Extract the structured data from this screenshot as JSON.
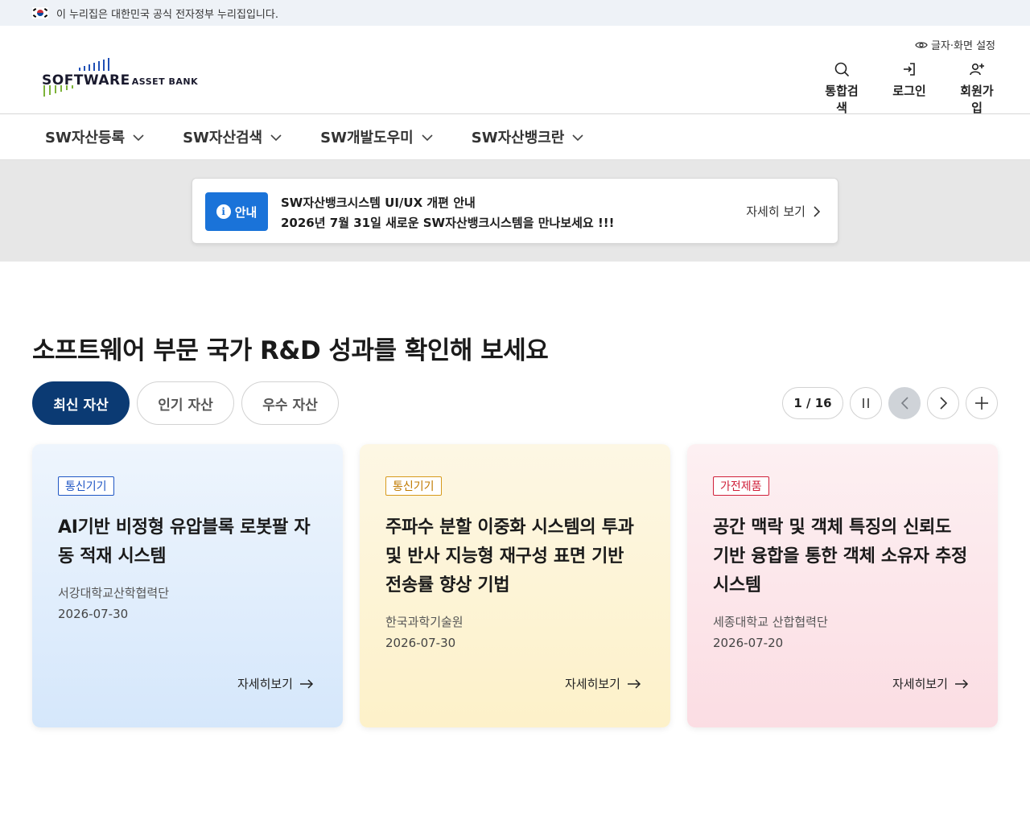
{
  "gov_banner": {
    "text": "이 누리집은 대한민국 공식 전자정부 누리집입니다."
  },
  "logo": {
    "main": "SOFTWARE",
    "sub": "ASSET BANK"
  },
  "header": {
    "settings_label": "글자·화면 설정",
    "utility": [
      {
        "label": "통합검색",
        "icon": "search-icon"
      },
      {
        "label": "로그인",
        "icon": "login-icon"
      },
      {
        "label": "회원가입",
        "icon": "user-add-icon"
      }
    ]
  },
  "nav": {
    "items": [
      {
        "label": "SW자산등록"
      },
      {
        "label": "SW자산검색"
      },
      {
        "label": "SW개발도우미"
      },
      {
        "label": "SW자산뱅크란"
      }
    ]
  },
  "notice": {
    "badge": "안내",
    "line1": "SW자산뱅크시스템 UI/UX 개편 안내",
    "line2": "2026년 7월 31일 새로운 SW자산뱅크시스템을 만나보세요 !!!",
    "more": "자세히 보기"
  },
  "section": {
    "title": "소프트웨어 부문 국가 R&D 성과를 확인해 보세요",
    "tabs": [
      {
        "label": "최신 자산",
        "active": true
      },
      {
        "label": "인기 자산",
        "active": false
      },
      {
        "label": "우수 자산",
        "active": false
      }
    ],
    "pager": "1 / 16"
  },
  "cards": [
    {
      "category": "통신기기",
      "title": "AI기반 비정형 유압블록 로봇팔 자동 적재 시스템",
      "org": "서강대학교산학협력단",
      "date": "2026-07-30",
      "more": "자세히보기",
      "color": "#1f56c4"
    },
    {
      "category": "통신기기",
      "title": "주파수 분할 이중화 시스템의 투과 및 반사 지능형 재구성 표면 기반 전송률 향상 기법",
      "org": "한국과학기술원",
      "date": "2026-07-30",
      "more": "자세히보기",
      "color": "#d79a1c"
    },
    {
      "category": "가전제품",
      "title": "공간 맥락 및 객체 특징의 신뢰도 기반 융합을 통한 객체 소유자 추정 시스템",
      "org": "세종대학교 산합협력단",
      "date": "2026-07-20",
      "more": "자세히보기",
      "color": "#d0203a"
    }
  ],
  "colors": {
    "primary": "#0b3a73",
    "notice_badge": "#1a73d9"
  }
}
